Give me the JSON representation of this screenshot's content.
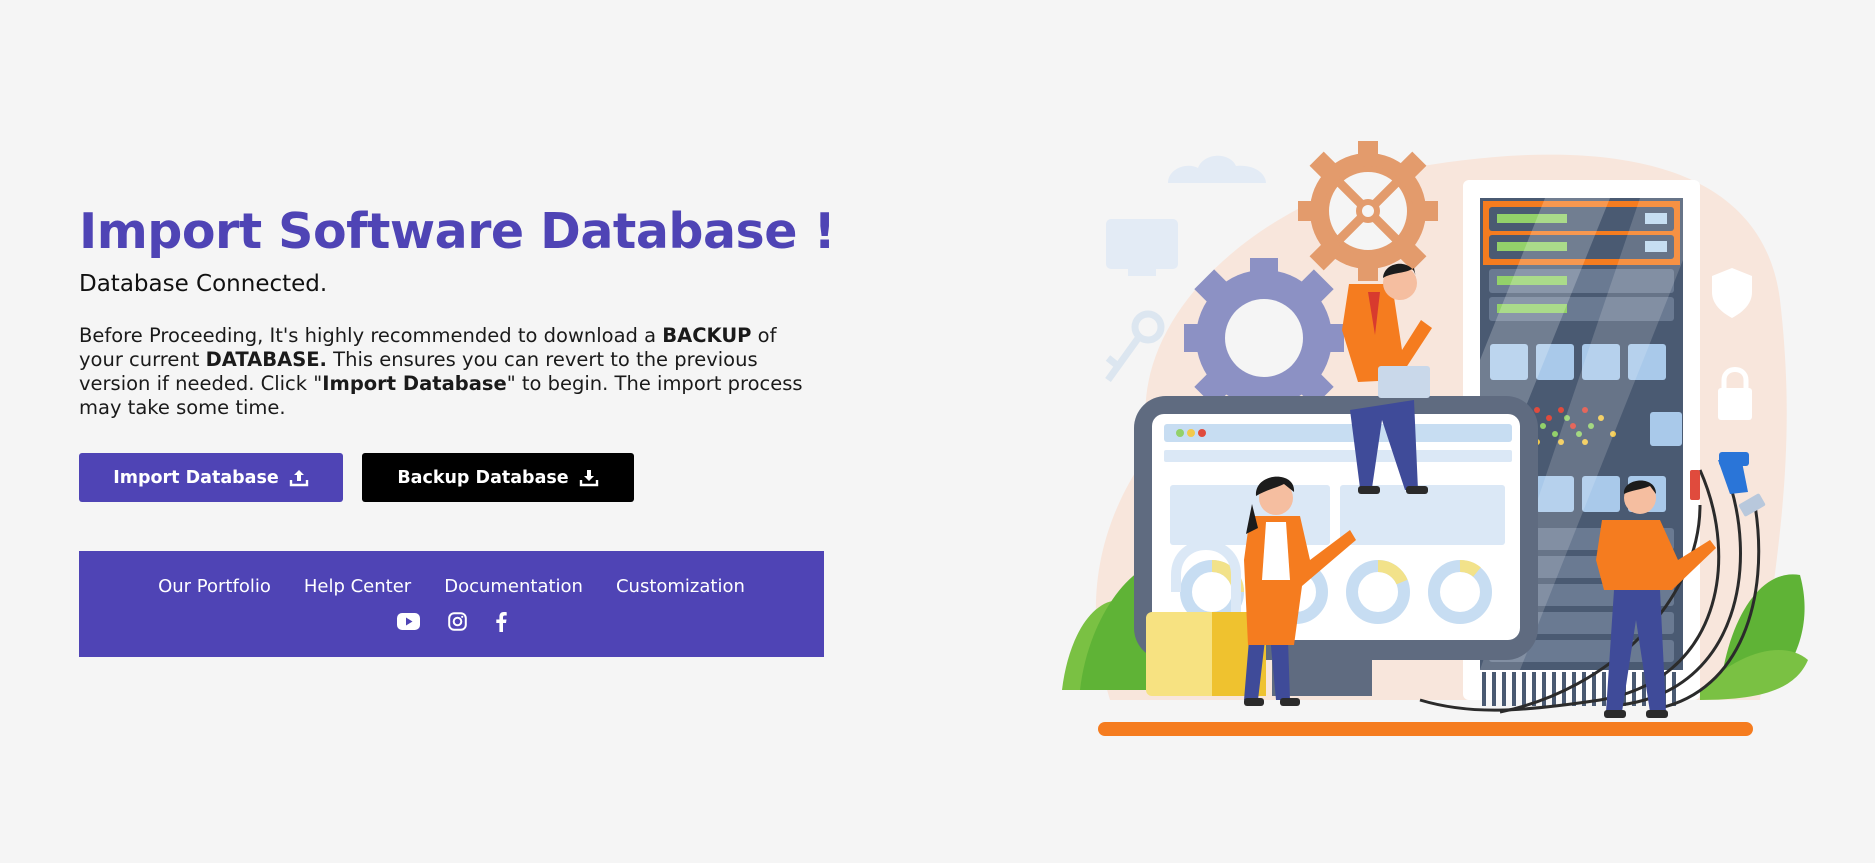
{
  "heading": {
    "title": "Import Software Database !",
    "subtitle": "Database Connected."
  },
  "description": {
    "t1": "Before Proceeding, It's highly recommended to download a ",
    "b1": "BACKUP",
    "t2": " of your current ",
    "b2": "DATABASE.",
    "t3": " This ensures you can revert to the previous version if needed. Click \"",
    "b3": "Import Database",
    "t4": "\" to begin. The import process may take some time."
  },
  "buttons": {
    "import_label": "Import Database",
    "import_icon": "upload-icon",
    "backup_label": "Backup Database",
    "backup_icon": "download-icon"
  },
  "footer": {
    "links": [
      "Our Portfolio",
      "Help Center",
      "Documentation",
      "Customization"
    ],
    "social_icons": [
      "youtube-icon",
      "instagram-icon",
      "facebook-icon"
    ]
  },
  "colors": {
    "primary": "#4f44b5",
    "secondary": "#000000",
    "background": "#f5f5f5",
    "accent": "#f57c1f"
  }
}
